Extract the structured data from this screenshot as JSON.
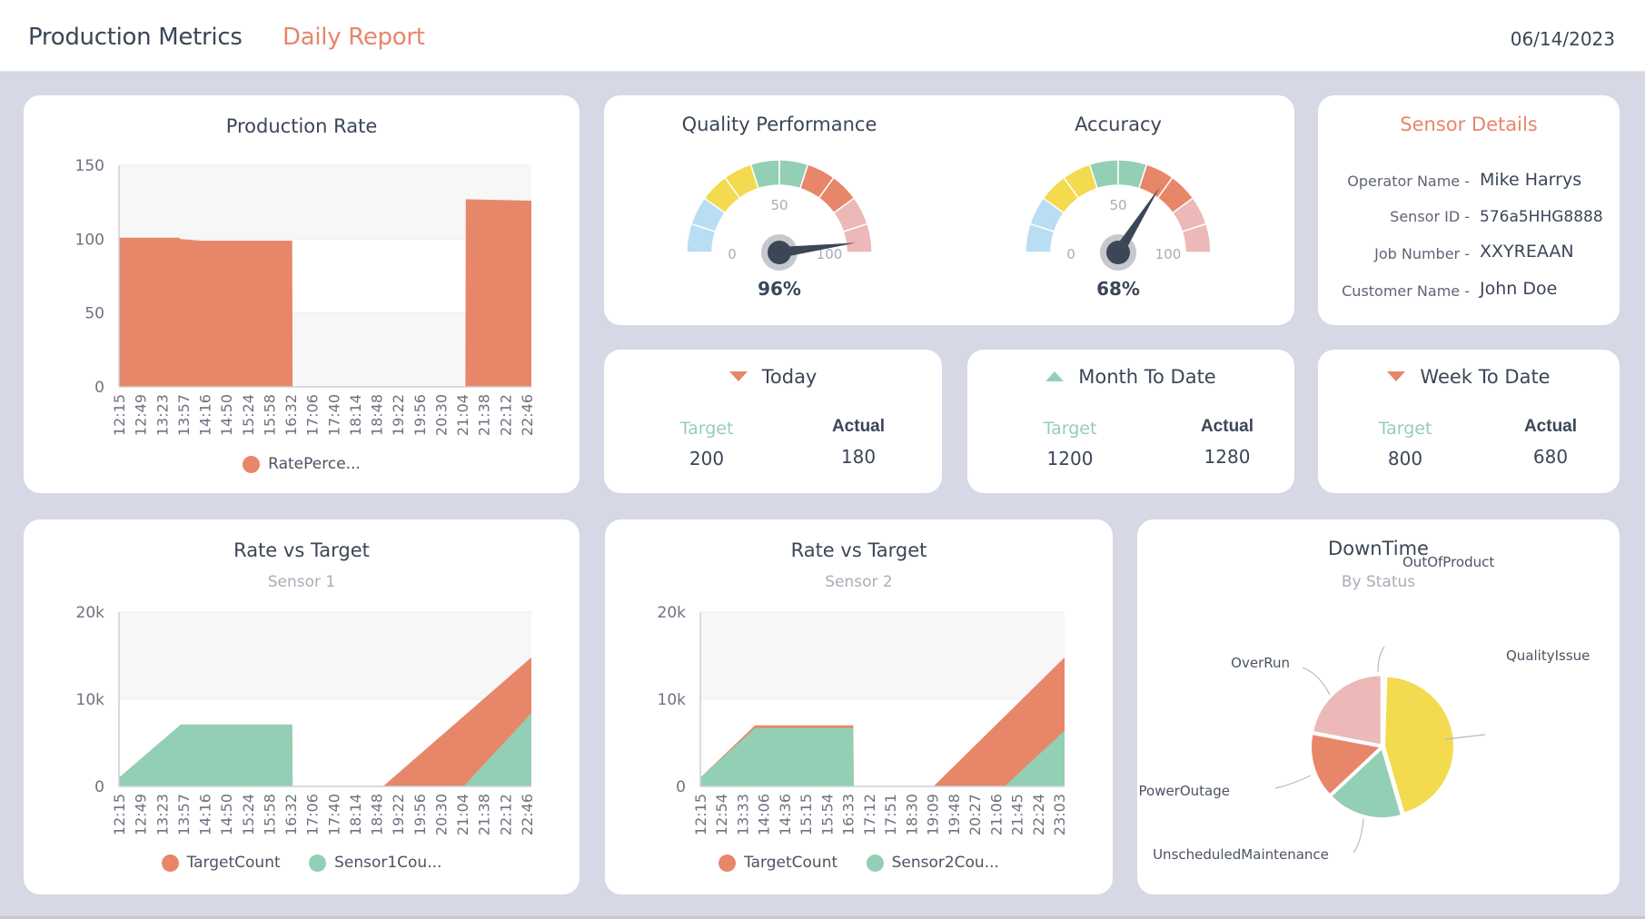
{
  "header": {
    "title": "Production Metrics",
    "subtitle": "Daily Report",
    "date": "06/14/2023"
  },
  "colors": {
    "accent_orange": "#e8866a",
    "accent_green": "#93cfb4",
    "yellow": "#f3da4f",
    "light_blue": "#b9ddf2",
    "pink": "#ecb8b8",
    "text_dark": "#3b4657",
    "page_bg": "#d6d8e5"
  },
  "production_rate": {
    "title": "Production Rate",
    "legend": [
      {
        "label": "RatePerce...",
        "color": "#e8866a"
      }
    ]
  },
  "gauges": [
    {
      "title": "Quality Performance",
      "value_label": "96%",
      "tick_min": "0",
      "tick_mid": "50",
      "tick_max": "100"
    },
    {
      "title": "Accuracy",
      "value_label": "68%",
      "tick_min": "0",
      "tick_mid": "50",
      "tick_max": "100"
    }
  ],
  "sensor_details": {
    "title": "Sensor Details",
    "rows": [
      {
        "label": "Operator Name -",
        "value": "Mike Harrys"
      },
      {
        "label": "Sensor ID -",
        "value": "576a5HHG8888"
      },
      {
        "label": "Job Number -",
        "value": "XXYREAAN"
      },
      {
        "label": "Customer Name -",
        "value": "John Doe"
      }
    ]
  },
  "kpis": [
    {
      "title": "Today",
      "trend": "down",
      "trend_icon": "triangle-down-icon",
      "target_label": "Target",
      "actual_label": "Actual",
      "target": "200",
      "actual": "180"
    },
    {
      "title": "Month To Date",
      "trend": "up",
      "trend_icon": "triangle-up-icon",
      "target_label": "Target",
      "actual_label": "Actual",
      "target": "1200",
      "actual": "1280"
    },
    {
      "title": "Week To Date",
      "trend": "down",
      "trend_icon": "triangle-down-icon",
      "target_label": "Target",
      "actual_label": "Actual",
      "target": "800",
      "actual": "680"
    }
  ],
  "sensor1_chart": {
    "title": "Rate vs Target",
    "subtitle": "Sensor 1",
    "legend": [
      {
        "label": "TargetCount",
        "color": "#e8866a"
      },
      {
        "label": "Sensor1Cou...",
        "color": "#93cfb4"
      }
    ]
  },
  "sensor2_chart": {
    "title": "Rate vs Target",
    "subtitle": "Sensor 2",
    "legend": [
      {
        "label": "TargetCount",
        "color": "#e8866a"
      },
      {
        "label": "Sensor2Cou...",
        "color": "#93cfb4"
      }
    ]
  },
  "downtime_chart": {
    "title": "DownTime",
    "subtitle": "By Status"
  },
  "chart_data": [
    {
      "id": "production_rate",
      "type": "area",
      "title": "Production Rate",
      "xlabel": "",
      "ylabel": "",
      "ylim": [
        0,
        150
      ],
      "yticks": [
        0,
        50,
        100,
        150
      ],
      "grid": true,
      "legend_position": "bottom",
      "categories": [
        "12:15",
        "12:49",
        "13:23",
        "13:57",
        "14:16",
        "14:50",
        "15:24",
        "15:58",
        "16:32",
        "17:06",
        "17:40",
        "18:14",
        "18:48",
        "19:22",
        "19:56",
        "20:30",
        "21:04",
        "21:38",
        "22:12",
        "22:46"
      ],
      "series": [
        {
          "name": "RatePerce...",
          "color": "#e8866a",
          "x_fraction": [
            0,
            0.145,
            0.15,
            0.2,
            0.42,
            0.421,
            0.84,
            0.841,
            1.0
          ],
          "values": [
            101,
            101,
            100,
            99,
            99,
            0,
            0,
            127,
            126
          ]
        }
      ]
    },
    {
      "id": "quality_gauge",
      "type": "gauge",
      "title": "Quality Performance",
      "min": 0,
      "max": 100,
      "value": 96,
      "bands": [
        {
          "from": 0,
          "to": 20,
          "color": "#b9ddf2"
        },
        {
          "from": 20,
          "to": 40,
          "color": "#f3da4f"
        },
        {
          "from": 40,
          "to": 60,
          "color": "#93cfb4"
        },
        {
          "from": 60,
          "to": 80,
          "color": "#e8866a"
        },
        {
          "from": 80,
          "to": 100,
          "color": "#ecb8b8"
        }
      ]
    },
    {
      "id": "accuracy_gauge",
      "type": "gauge",
      "title": "Accuracy",
      "min": 0,
      "max": 100,
      "value": 68,
      "bands": [
        {
          "from": 0,
          "to": 20,
          "color": "#b9ddf2"
        },
        {
          "from": 20,
          "to": 40,
          "color": "#f3da4f"
        },
        {
          "from": 40,
          "to": 60,
          "color": "#93cfb4"
        },
        {
          "from": 60,
          "to": 80,
          "color": "#e8866a"
        },
        {
          "from": 80,
          "to": 100,
          "color": "#ecb8b8"
        }
      ]
    },
    {
      "id": "sensor1",
      "type": "area",
      "title": "Rate vs Target",
      "subtitle": "Sensor 1",
      "ylim": [
        0,
        20000
      ],
      "yticks": [
        0,
        10000,
        20000
      ],
      "ytick_labels": [
        "0",
        "10k",
        "20k"
      ],
      "grid": true,
      "legend_position": "bottom",
      "categories": [
        "12:15",
        "12:49",
        "13:23",
        "13:57",
        "14:16",
        "14:50",
        "15:24",
        "15:58",
        "16:32",
        "17:06",
        "17:40",
        "18:14",
        "18:48",
        "19:22",
        "19:56",
        "20:30",
        "21:04",
        "21:38",
        "22:12",
        "22:46"
      ],
      "series": [
        {
          "name": "TargetCount",
          "color": "#e8866a",
          "x_fraction": [
            0,
            0.15,
            0.42,
            0.421,
            0.64,
            1.0
          ],
          "values": [
            1000,
            7100,
            7100,
            0,
            0,
            14800
          ]
        },
        {
          "name": "Sensor1Cou...",
          "color": "#93cfb4",
          "x_fraction": [
            0,
            0.15,
            0.42,
            0.421,
            0.835,
            1.0
          ],
          "values": [
            1000,
            7100,
            7100,
            0,
            0,
            8400
          ]
        }
      ]
    },
    {
      "id": "sensor2",
      "type": "area",
      "title": "Rate vs Target",
      "subtitle": "Sensor 2",
      "ylim": [
        0,
        20000
      ],
      "yticks": [
        0,
        10000,
        20000
      ],
      "ytick_labels": [
        "0",
        "10k",
        "20k"
      ],
      "grid": true,
      "legend_position": "bottom",
      "categories": [
        "12:15",
        "12:54",
        "13:33",
        "14:06",
        "14:36",
        "15:15",
        "15:54",
        "16:33",
        "17:12",
        "17:51",
        "18:30",
        "19:09",
        "19:48",
        "20:27",
        "21:06",
        "21:45",
        "22:24",
        "23:03"
      ],
      "series": [
        {
          "name": "TargetCount",
          "color": "#e8866a",
          "x_fraction": [
            0,
            0.15,
            0.42,
            0.421,
            0.64,
            1.0
          ],
          "values": [
            1000,
            7000,
            7000,
            0,
            0,
            14800
          ]
        },
        {
          "name": "Sensor2Cou...",
          "color": "#93cfb4",
          "x_fraction": [
            0,
            0.15,
            0.42,
            0.421,
            0.835,
            1.0
          ],
          "values": [
            1000,
            6700,
            6700,
            0,
            0,
            6400
          ]
        }
      ]
    },
    {
      "id": "downtime",
      "type": "pie",
      "title": "DownTime",
      "subtitle": "By Status",
      "slices": [
        {
          "label": "OutOfProduct",
          "value": 0.5,
          "color": "#b9ddf2"
        },
        {
          "label": "QualityIssue",
          "value": 45,
          "color": "#f3da4f"
        },
        {
          "label": "UnscheduledMaintenance",
          "value": 17.5,
          "color": "#93cfb4"
        },
        {
          "label": "PowerOutage",
          "value": 15,
          "color": "#e8866a"
        },
        {
          "label": "OverRun",
          "value": 22,
          "color": "#ecb8b8"
        }
      ]
    }
  ]
}
